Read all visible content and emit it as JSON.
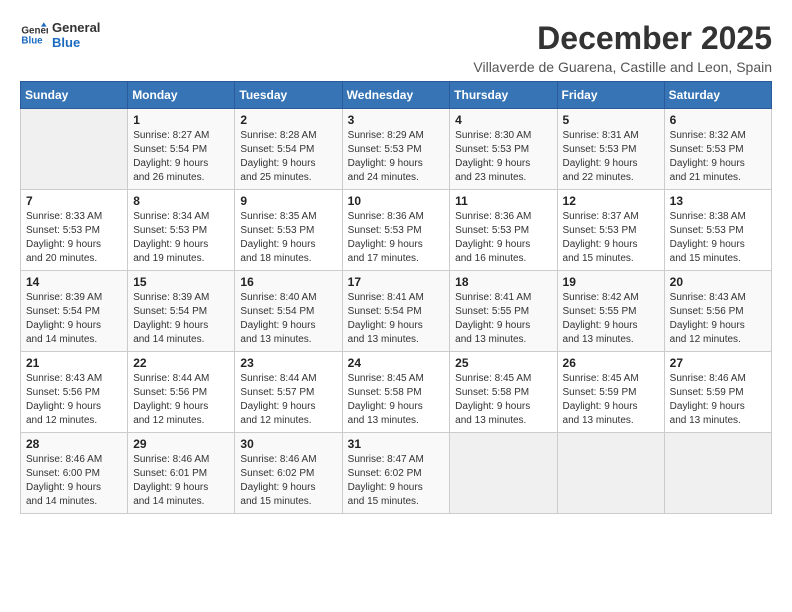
{
  "logo": {
    "line1": "General",
    "line2": "Blue"
  },
  "title": "December 2025",
  "subtitle": "Villaverde de Guarena, Castille and Leon, Spain",
  "weekdays": [
    "Sunday",
    "Monday",
    "Tuesday",
    "Wednesday",
    "Thursday",
    "Friday",
    "Saturday"
  ],
  "weeks": [
    [
      {
        "day": "",
        "info": ""
      },
      {
        "day": "1",
        "info": "Sunrise: 8:27 AM\nSunset: 5:54 PM\nDaylight: 9 hours\nand 26 minutes."
      },
      {
        "day": "2",
        "info": "Sunrise: 8:28 AM\nSunset: 5:54 PM\nDaylight: 9 hours\nand 25 minutes."
      },
      {
        "day": "3",
        "info": "Sunrise: 8:29 AM\nSunset: 5:53 PM\nDaylight: 9 hours\nand 24 minutes."
      },
      {
        "day": "4",
        "info": "Sunrise: 8:30 AM\nSunset: 5:53 PM\nDaylight: 9 hours\nand 23 minutes."
      },
      {
        "day": "5",
        "info": "Sunrise: 8:31 AM\nSunset: 5:53 PM\nDaylight: 9 hours\nand 22 minutes."
      },
      {
        "day": "6",
        "info": "Sunrise: 8:32 AM\nSunset: 5:53 PM\nDaylight: 9 hours\nand 21 minutes."
      }
    ],
    [
      {
        "day": "7",
        "info": "Sunrise: 8:33 AM\nSunset: 5:53 PM\nDaylight: 9 hours\nand 20 minutes."
      },
      {
        "day": "8",
        "info": "Sunrise: 8:34 AM\nSunset: 5:53 PM\nDaylight: 9 hours\nand 19 minutes."
      },
      {
        "day": "9",
        "info": "Sunrise: 8:35 AM\nSunset: 5:53 PM\nDaylight: 9 hours\nand 18 minutes."
      },
      {
        "day": "10",
        "info": "Sunrise: 8:36 AM\nSunset: 5:53 PM\nDaylight: 9 hours\nand 17 minutes."
      },
      {
        "day": "11",
        "info": "Sunrise: 8:36 AM\nSunset: 5:53 PM\nDaylight: 9 hours\nand 16 minutes."
      },
      {
        "day": "12",
        "info": "Sunrise: 8:37 AM\nSunset: 5:53 PM\nDaylight: 9 hours\nand 15 minutes."
      },
      {
        "day": "13",
        "info": "Sunrise: 8:38 AM\nSunset: 5:53 PM\nDaylight: 9 hours\nand 15 minutes."
      }
    ],
    [
      {
        "day": "14",
        "info": "Sunrise: 8:39 AM\nSunset: 5:54 PM\nDaylight: 9 hours\nand 14 minutes."
      },
      {
        "day": "15",
        "info": "Sunrise: 8:39 AM\nSunset: 5:54 PM\nDaylight: 9 hours\nand 14 minutes."
      },
      {
        "day": "16",
        "info": "Sunrise: 8:40 AM\nSunset: 5:54 PM\nDaylight: 9 hours\nand 13 minutes."
      },
      {
        "day": "17",
        "info": "Sunrise: 8:41 AM\nSunset: 5:54 PM\nDaylight: 9 hours\nand 13 minutes."
      },
      {
        "day": "18",
        "info": "Sunrise: 8:41 AM\nSunset: 5:55 PM\nDaylight: 9 hours\nand 13 minutes."
      },
      {
        "day": "19",
        "info": "Sunrise: 8:42 AM\nSunset: 5:55 PM\nDaylight: 9 hours\nand 13 minutes."
      },
      {
        "day": "20",
        "info": "Sunrise: 8:43 AM\nSunset: 5:56 PM\nDaylight: 9 hours\nand 12 minutes."
      }
    ],
    [
      {
        "day": "21",
        "info": "Sunrise: 8:43 AM\nSunset: 5:56 PM\nDaylight: 9 hours\nand 12 minutes."
      },
      {
        "day": "22",
        "info": "Sunrise: 8:44 AM\nSunset: 5:56 PM\nDaylight: 9 hours\nand 12 minutes."
      },
      {
        "day": "23",
        "info": "Sunrise: 8:44 AM\nSunset: 5:57 PM\nDaylight: 9 hours\nand 12 minutes."
      },
      {
        "day": "24",
        "info": "Sunrise: 8:45 AM\nSunset: 5:58 PM\nDaylight: 9 hours\nand 13 minutes."
      },
      {
        "day": "25",
        "info": "Sunrise: 8:45 AM\nSunset: 5:58 PM\nDaylight: 9 hours\nand 13 minutes."
      },
      {
        "day": "26",
        "info": "Sunrise: 8:45 AM\nSunset: 5:59 PM\nDaylight: 9 hours\nand 13 minutes."
      },
      {
        "day": "27",
        "info": "Sunrise: 8:46 AM\nSunset: 5:59 PM\nDaylight: 9 hours\nand 13 minutes."
      }
    ],
    [
      {
        "day": "28",
        "info": "Sunrise: 8:46 AM\nSunset: 6:00 PM\nDaylight: 9 hours\nand 14 minutes."
      },
      {
        "day": "29",
        "info": "Sunrise: 8:46 AM\nSunset: 6:01 PM\nDaylight: 9 hours\nand 14 minutes."
      },
      {
        "day": "30",
        "info": "Sunrise: 8:46 AM\nSunset: 6:02 PM\nDaylight: 9 hours\nand 15 minutes."
      },
      {
        "day": "31",
        "info": "Sunrise: 8:47 AM\nSunset: 6:02 PM\nDaylight: 9 hours\nand 15 minutes."
      },
      {
        "day": "",
        "info": ""
      },
      {
        "day": "",
        "info": ""
      },
      {
        "day": "",
        "info": ""
      }
    ]
  ]
}
